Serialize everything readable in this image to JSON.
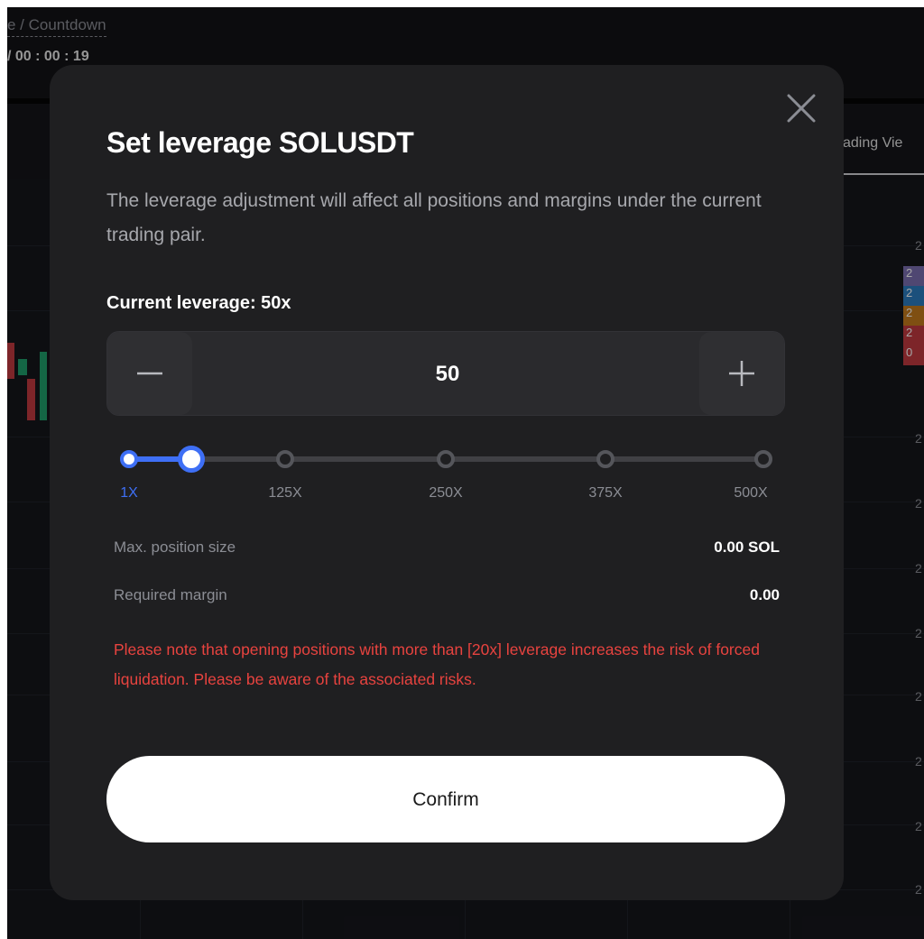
{
  "background": {
    "countdown_label": "e / Countdown",
    "countdown_value": "/ 00 : 00 : 19",
    "tab_label": "ading Vie",
    "axis_labels": [
      "2",
      "2",
      "2",
      "2",
      "2",
      "2",
      "2",
      "2",
      "2",
      "2"
    ],
    "price_tags": [
      {
        "text": "2",
        "color": "#7a6db0"
      },
      {
        "text": "2",
        "color": "#2b7bbf"
      },
      {
        "text": "2",
        "color": "#c47a1d"
      },
      {
        "text": "2",
        "color": "#c0393f"
      },
      {
        "text": "0",
        "color": "#c0393f"
      }
    ]
  },
  "modal": {
    "title": "Set leverage  SOLUSDT",
    "description": "The leverage adjustment will affect all positions and margins under the current trading pair.",
    "current_label": "Current leverage: 50x",
    "stepper": {
      "value": "50",
      "decrement_icon": "minus-icon",
      "increment_icon": "plus-icon"
    },
    "slider": {
      "min": 1,
      "max": 500,
      "value": 50,
      "marks": [
        "1X",
        "125X",
        "250X",
        "375X",
        "500X"
      ],
      "accent": "#3e6ff5"
    },
    "info": [
      {
        "label": "Max. position size",
        "value": "0.00 SOL"
      },
      {
        "label": "Required margin",
        "value": "0.00"
      }
    ],
    "warning": "Please note that opening positions with more than [20x] leverage increases the risk of forced liquidation. Please be aware of the associated risks.",
    "warning_color": "#e8433f",
    "confirm_label": "Confirm",
    "close_icon": "close-icon"
  }
}
